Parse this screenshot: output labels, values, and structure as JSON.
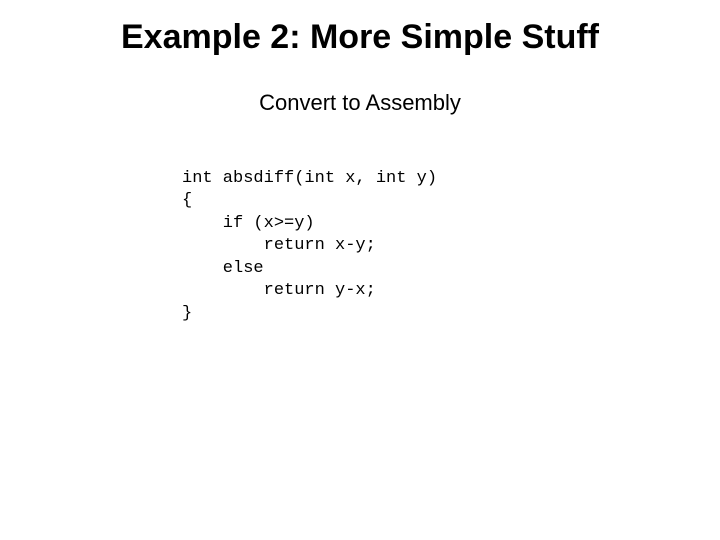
{
  "title": "Example 2: More Simple Stuff",
  "subtitle": "Convert to Assembly",
  "code": {
    "l1": "int absdiff(int x, int y)",
    "l2": "{",
    "l3": "    if (x>=y)",
    "l4": "        return x-y;",
    "l5": "    else",
    "l6": "        return y-x;",
    "l7": "}"
  }
}
